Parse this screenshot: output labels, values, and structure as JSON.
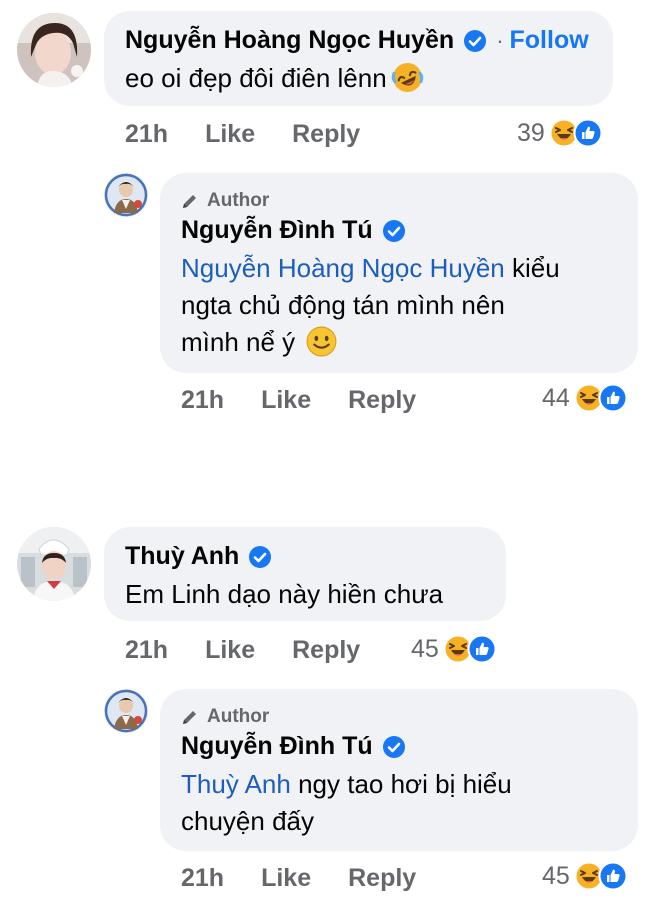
{
  "comments": [
    {
      "author": "Nguyễn Hoàng Ngọc Huyền",
      "follow_label": "Follow",
      "follow_separator": "·",
      "text": "eo oi đẹp đôi điên lênn",
      "emoji_icon": "rolling-laughing-emoji",
      "time": "21h",
      "like_label": "Like",
      "reply_label": "Reply",
      "reaction_count": "39"
    },
    {
      "author_badge": "Author",
      "author": "Nguyễn Đình Tú",
      "mention": "Nguyễn Hoàng Ngọc Huyền",
      "text_line1": " kiểu",
      "text_line2": "ngta chủ động tán mình nên",
      "text_line3": "mình nể ý",
      "emoji_icon": "smiling-face-emoji",
      "time": "21h",
      "like_label": "Like",
      "reply_label": "Reply",
      "reaction_count": "44"
    },
    {
      "author": "Thuỳ Anh",
      "text": "Em Linh dạo này hiền chưa",
      "time": "21h",
      "like_label": "Like",
      "reply_label": "Reply",
      "reaction_count": "45"
    },
    {
      "author_badge": "Author",
      "author": "Nguyễn Đình Tú",
      "mention": "Thuỳ Anh",
      "text_line1": " ngy tao hơi bị hiểu",
      "text_line2": "chuyện đấy",
      "time": "21h",
      "like_label": "Like",
      "reply_label": "Reply",
      "reaction_count": "45"
    }
  ],
  "icons": {
    "verified": "verified-badge-icon",
    "author_pen": "pen-icon",
    "reaction_haha": "haha-reaction-icon",
    "reaction_like": "like-reaction-icon"
  },
  "colors": {
    "bubble": "#f0f2f5",
    "link_blue": "#1877f2",
    "mention_blue": "#1d5ebd",
    "meta_gray": "#65676b",
    "haha_yellow": "#f7b125",
    "like_blue": "#1877f2"
  }
}
